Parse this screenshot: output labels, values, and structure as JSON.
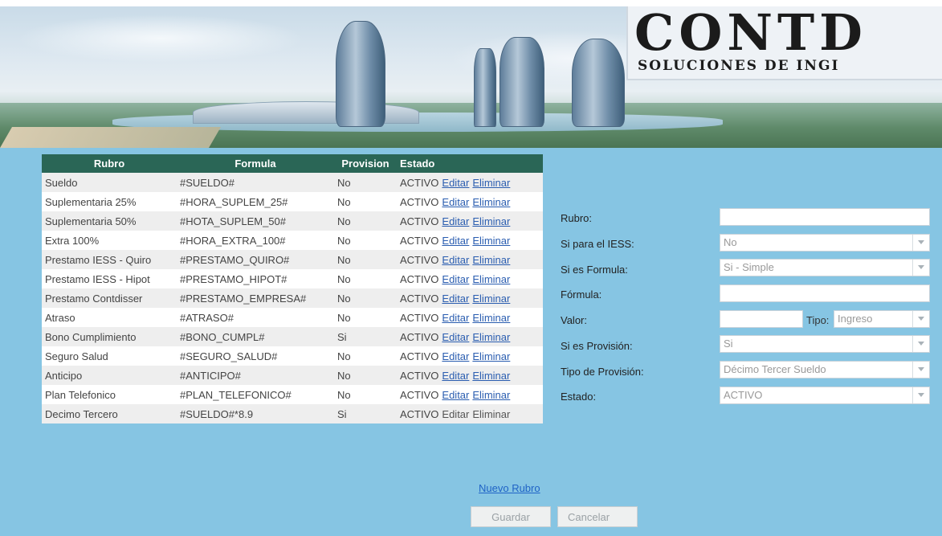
{
  "banner": {
    "logo_title": "CONTD",
    "logo_subtitle": "SOLUCIONES DE INGI"
  },
  "table": {
    "headers": [
      "Rubro",
      "Formula",
      "Provision",
      "Estado"
    ],
    "rows": [
      {
        "rubro": "Sueldo",
        "formula": "#SUELDO#",
        "provision": "No",
        "estado": "ACTIVO",
        "edit": "Editar",
        "delete": "Eliminar"
      },
      {
        "rubro": "Suplementaria 25%",
        "formula": "#HORA_SUPLEM_25#",
        "provision": "No",
        "estado": "ACTIVO",
        "edit": "Editar",
        "delete": "Eliminar"
      },
      {
        "rubro": "Suplementaria 50%",
        "formula": "#HOTA_SUPLEM_50#",
        "provision": "No",
        "estado": "ACTIVO",
        "edit": "Editar",
        "delete": "Eliminar"
      },
      {
        "rubro": "Extra 100%",
        "formula": "#HORA_EXTRA_100#",
        "provision": "No",
        "estado": "ACTIVO",
        "edit": "Editar",
        "delete": "Eliminar"
      },
      {
        "rubro": "Prestamo IESS - Quiro",
        "formula": "#PRESTAMO_QUIRO#",
        "provision": "No",
        "estado": "ACTIVO",
        "edit": "Editar",
        "delete": "Eliminar"
      },
      {
        "rubro": "Prestamo IESS - Hipot",
        "formula": "#PRESTAMO_HIPOT#",
        "provision": "No",
        "estado": "ACTIVO",
        "edit": "Editar",
        "delete": "Eliminar"
      },
      {
        "rubro": "Prestamo Contdisser",
        "formula": "#PRESTAMO_EMPRESA#",
        "provision": "No",
        "estado": "ACTIVO",
        "edit": "Editar",
        "delete": "Eliminar"
      },
      {
        "rubro": "Atraso",
        "formula": "#ATRASO#",
        "provision": "No",
        "estado": "ACTIVO",
        "edit": "Editar",
        "delete": "Eliminar"
      },
      {
        "rubro": "Bono Cumplimiento",
        "formula": "#BONO_CUMPL#",
        "provision": "Si",
        "estado": "ACTIVO",
        "edit": "Editar",
        "delete": "Eliminar"
      },
      {
        "rubro": "Seguro Salud",
        "formula": "#SEGURO_SALUD#",
        "provision": "No",
        "estado": "ACTIVO",
        "edit": "Editar",
        "delete": "Eliminar"
      },
      {
        "rubro": "Anticipo",
        "formula": "#ANTICIPO#",
        "provision": "No",
        "estado": "ACTIVO",
        "edit": "Editar",
        "delete": "Eliminar"
      },
      {
        "rubro": "Plan Telefonico",
        "formula": "#PLAN_TELEFONICO#",
        "provision": "No",
        "estado": "ACTIVO",
        "edit": "Editar",
        "delete": "Eliminar"
      },
      {
        "rubro": "Decimo Tercero",
        "formula": "#SUELDO#*8.9",
        "provision": "Si",
        "estado": "ACTIVO",
        "edit": "Editar",
        "delete": "Eliminar"
      }
    ]
  },
  "new_link": "Nuevo Rubro",
  "buttons": {
    "save": "Guardar",
    "cancel": "Cancelar"
  },
  "form": {
    "rubro_label": "Rubro:",
    "rubro_value": "",
    "iess_label": "Si para el IESS:",
    "iess_value": "No",
    "formula_type_label": "Si es Formula:",
    "formula_type_value": "Si - Simple",
    "formula_label": "Fórmula:",
    "formula_value": "",
    "valor_label": "Valor:",
    "valor_value": "",
    "tipo_label": "Tipo:",
    "tipo_value": "Ingreso",
    "provision_label": "Si es Provisión:",
    "provision_value": "Si",
    "provision_type_label": "Tipo de Provisión:",
    "provision_type_value": "Décimo Tercer Sueldo",
    "estado_label": "Estado:",
    "estado_value": "ACTIVO"
  },
  "colors": {
    "header_bg": "#2a6656",
    "content_bg": "#86c5e3",
    "link": "#2a5db0"
  }
}
